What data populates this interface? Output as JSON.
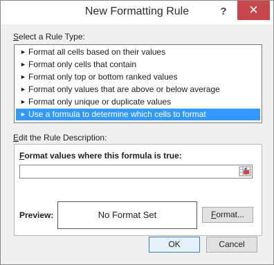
{
  "window": {
    "title": "New Formatting Rule",
    "help_glyph": "?",
    "close_glyph": "✕"
  },
  "rule_type": {
    "label": "Select a Rule Type:",
    "items": [
      {
        "label": "Format all cells based on their values"
      },
      {
        "label": "Format only cells that contain"
      },
      {
        "label": "Format only top or bottom ranked values"
      },
      {
        "label": "Format only values that are above or below average"
      },
      {
        "label": "Format only unique or duplicate values"
      },
      {
        "label": "Use a formula to determine which cells to format"
      }
    ],
    "selected_index": 5,
    "arrow_glyph": "►"
  },
  "description": {
    "label": "Edit the Rule Description:",
    "formula_label": "Format values where this formula is true:",
    "formula_value": ""
  },
  "preview": {
    "label": "Preview:",
    "text": "No Format Set",
    "format_button": "Format..."
  },
  "buttons": {
    "ok": "OK",
    "cancel": "Cancel"
  },
  "colors": {
    "selection": "#3399ff",
    "close": "#c7474c"
  },
  "icons": {
    "collapse_ref": "range-selector-icon"
  }
}
